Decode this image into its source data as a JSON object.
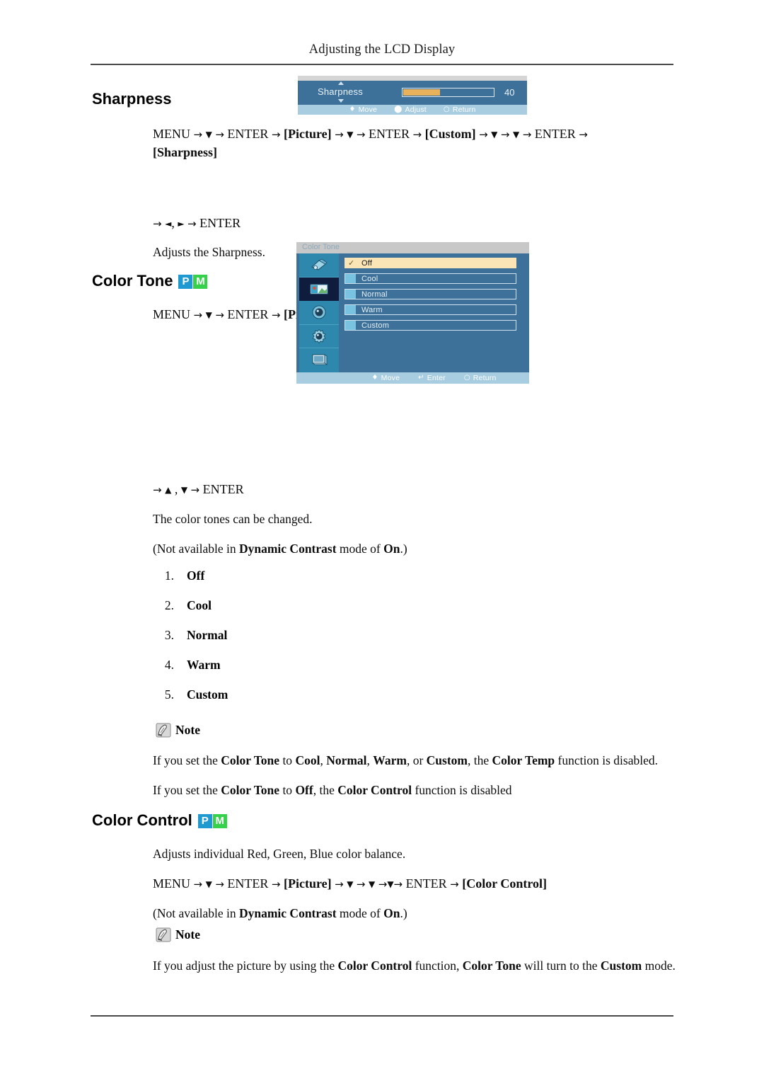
{
  "header": {
    "title": "Adjusting the LCD Display"
  },
  "sharpness": {
    "heading": "Sharpness",
    "nav_line_1": "MENU → ▼ → ENTER → [Picture] → ▼ → ENTER → [Custom] → ▼ → ▼ → ENTER →",
    "nav_line_2": "[Sharpness]",
    "nav_line_after": "→ ◄, ► → ENTER",
    "description": "Adjusts the Sharpness.",
    "osd": {
      "label": "Sharpness",
      "value": "40",
      "fill_percent": 40,
      "hints": [
        {
          "glyph": "✜",
          "label": "Move"
        },
        {
          "glyph": "◄►",
          "label": "Adjust"
        },
        {
          "glyph": "↺",
          "label": "Return"
        }
      ]
    }
  },
  "color_tone": {
    "heading": "Color Tone",
    "badges": [
      {
        "letter": "P",
        "color": "#1f9ad0"
      },
      {
        "letter": "M",
        "color": "#35d14a"
      }
    ],
    "nav_line": "MENU → ▼ → ENTER → [Picture] → ▼ → ▼ →ENTER → [Color Tone]",
    "nav_line_after": "→ ▲ , ▼ → ENTER",
    "description": "The color tones can be changed.",
    "availability_note": "(Not available in Dynamic Contrast mode of On.)",
    "osd": {
      "title": "Color Tone",
      "selected_index": 0,
      "options": [
        "Off",
        "Cool",
        "Normal",
        "Warm",
        "Custom"
      ],
      "sidebar_icons": [
        "input-source-icon",
        "picture-icon",
        "sound-icon",
        "setup-gear-icon",
        "monitor-icon"
      ],
      "active_sidebar_index": 1,
      "hints": [
        {
          "glyph": "✜",
          "label": "Move"
        },
        {
          "glyph": "↵",
          "label": "Enter"
        },
        {
          "glyph": "↺",
          "label": "Return"
        }
      ]
    },
    "numbered_options": [
      {
        "n": "1.",
        "label": "Off"
      },
      {
        "n": "2.",
        "label": "Cool"
      },
      {
        "n": "3.",
        "label": "Normal"
      },
      {
        "n": "4.",
        "label": "Warm"
      },
      {
        "n": "5.",
        "label": "Custom"
      }
    ],
    "note_label": "Note",
    "note_line_1": "If you set the Color Tone to Cool, Normal, Warm, or Custom, the Color Temp function is disabled.",
    "note_line_2": "If you set the Color Tone to Off, the Color Control function is disabled"
  },
  "color_control": {
    "heading": "Color Control",
    "badges": [
      {
        "letter": "P",
        "color": "#1f9ad0"
      },
      {
        "letter": "M",
        "color": "#35d14a"
      }
    ],
    "description": "Adjusts individual Red, Green, Blue color balance.",
    "nav_line": "MENU → ▼ → ENTER → [Picture] → ▼ → ▼ →▼→ ENTER → [Color Control]",
    "availability_note": "(Not available in Dynamic Contrast mode of On.)",
    "note_label": "Note",
    "note_text": "If you adjust the picture by using the Color Control function, Color Tone will turn to the Custom mode."
  }
}
